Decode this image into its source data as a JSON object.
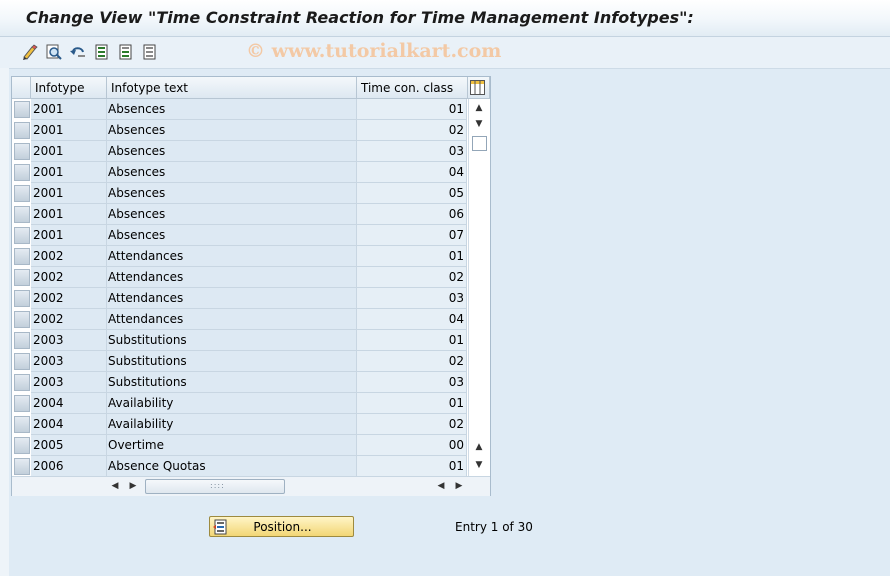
{
  "window": {
    "title": "Change View \"Time Constraint Reaction for Time Management Infotypes\":"
  },
  "toolbar": {
    "icons": [
      "edit-pencil-icon",
      "find-icon",
      "undo-icon",
      "select-all-icon",
      "select-block-icon",
      "deselect-all-icon"
    ],
    "watermark": "© www.tutorialkart.com"
  },
  "table": {
    "columns": [
      "Infotype",
      "Infotype text",
      "Time con. class"
    ],
    "rows": [
      {
        "infotype": "2001",
        "text": "Absences",
        "class": "01"
      },
      {
        "infotype": "2001",
        "text": "Absences",
        "class": "02"
      },
      {
        "infotype": "2001",
        "text": "Absences",
        "class": "03"
      },
      {
        "infotype": "2001",
        "text": "Absences",
        "class": "04"
      },
      {
        "infotype": "2001",
        "text": "Absences",
        "class": "05"
      },
      {
        "infotype": "2001",
        "text": "Absences",
        "class": "06"
      },
      {
        "infotype": "2001",
        "text": "Absences",
        "class": "07"
      },
      {
        "infotype": "2002",
        "text": "Attendances",
        "class": "01"
      },
      {
        "infotype": "2002",
        "text": "Attendances",
        "class": "02"
      },
      {
        "infotype": "2002",
        "text": "Attendances",
        "class": "03"
      },
      {
        "infotype": "2002",
        "text": "Attendances",
        "class": "04"
      },
      {
        "infotype": "2003",
        "text": "Substitutions",
        "class": "01"
      },
      {
        "infotype": "2003",
        "text": "Substitutions",
        "class": "02"
      },
      {
        "infotype": "2003",
        "text": "Substitutions",
        "class": "03"
      },
      {
        "infotype": "2004",
        "text": "Availability",
        "class": "01"
      },
      {
        "infotype": "2004",
        "text": "Availability",
        "class": "02"
      },
      {
        "infotype": "2005",
        "text": "Overtime",
        "class": "00"
      },
      {
        "infotype": "2006",
        "text": "Absence Quotas",
        "class": "01"
      }
    ]
  },
  "footer": {
    "position_button": "Position...",
    "entry_text": "Entry 1 of 30"
  },
  "colors": {
    "background": "#dfebf5",
    "button_yellow": "#f2d675",
    "row_bg": "#dde9f3"
  }
}
